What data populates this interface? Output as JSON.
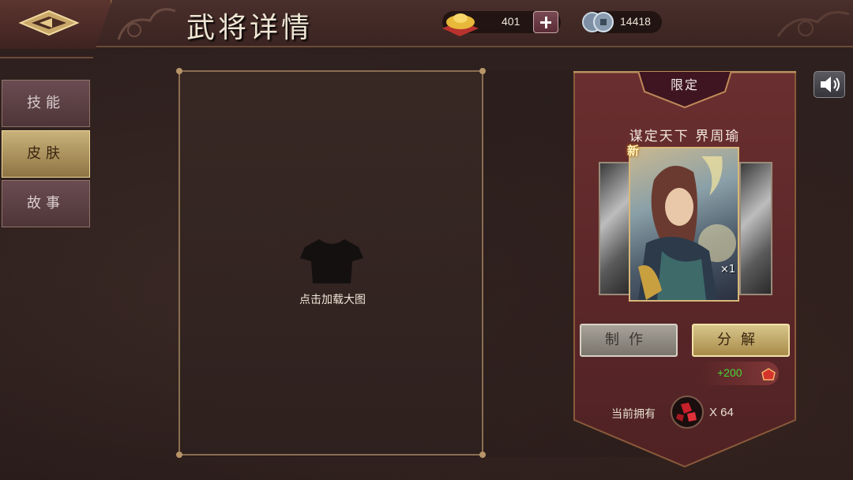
{
  "header": {
    "title": "武将详情",
    "gold_value": "401",
    "coin_value": "14418",
    "back_icon": "back-arrow-icon",
    "gold_icon": "gold-ingot-icon",
    "coin_icon": "coins-icon",
    "plus_icon": "plus-icon"
  },
  "tabs": [
    {
      "label": "技能",
      "active": false
    },
    {
      "label": "皮肤",
      "active": true
    },
    {
      "label": "故事",
      "active": false
    }
  ],
  "preview": {
    "load_text": "点击加载大图",
    "icon": "shirt-icon"
  },
  "skin": {
    "limited_label": "限定",
    "name": "谋定天下 界周瑜",
    "new_badge": "新",
    "count": "×1",
    "make_button": "制作",
    "split_button": "分解",
    "reward": "+200",
    "owned_label": "当前拥有",
    "owned_count": "X 64"
  },
  "colors": {
    "accent_gold": "#c9b27a",
    "banner_red": "#6a2f30",
    "reward_green": "#49d636"
  },
  "sound_icon": "speaker-icon"
}
